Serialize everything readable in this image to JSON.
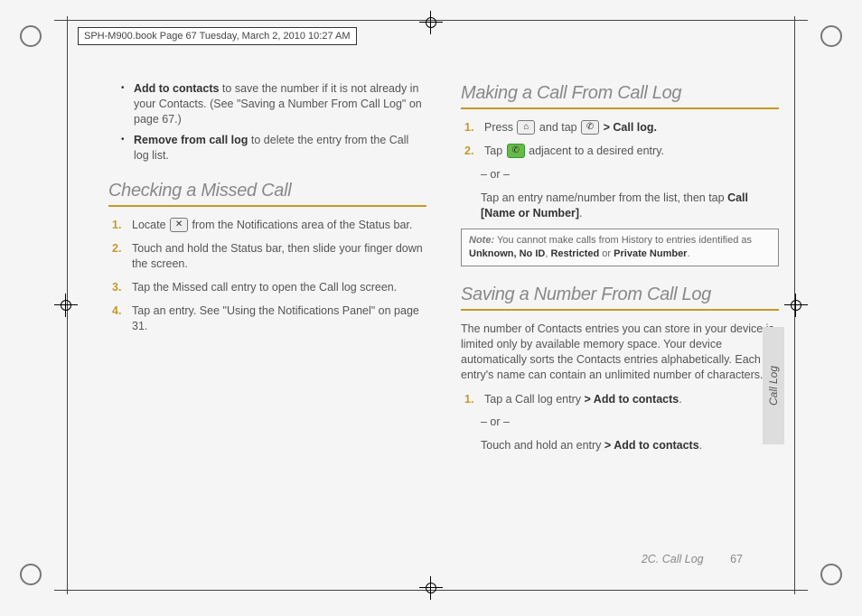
{
  "header": {
    "stamp": "SPH-M900.book  Page 67  Tuesday, March 2, 2010  10:27 AM"
  },
  "col1": {
    "bullets": [
      {
        "lead": "Add to contacts",
        "rest": " to save the number if it is not already in your Contacts. (See \"Saving a Number From Call Log\" on page 67.)"
      },
      {
        "lead": "Remove from call log",
        "rest": " to delete the entry from the Call log list."
      }
    ],
    "h1": "Checking a Missed Call",
    "steps": [
      {
        "pre": "Locate ",
        "icon": "missed-call-icon",
        "post": " from the Notifications area of the Status bar."
      },
      {
        "text": "Touch and hold the Status bar, then slide your finger down the screen."
      },
      {
        "text": "Tap the Missed call entry to open the Call log screen."
      },
      {
        "text": "Tap an entry. See \"Using the Notifications Panel\" on page 31."
      }
    ]
  },
  "col2": {
    "h1": "Making a Call From Call Log",
    "s1": {
      "pre": "Press ",
      "icon1": "home-icon",
      "mid": " and tap ",
      "icon2": "phone-icon",
      "gt": " > ",
      "boldend": "Call log."
    },
    "s2": {
      "pre": "Tap ",
      "icon": "call-green-icon",
      "post": " adjacent to a desired entry."
    },
    "or": "– or –",
    "s2b_a": "Tap an entry name/number from the list, then tap ",
    "s2b_b": "Call [Name or Number]",
    "s2b_c": ".",
    "note_label": "Note:",
    "note_a": " You cannot make calls from History to entries identified as ",
    "note_b": "Unknown, No ID",
    "note_c": ", ",
    "note_d": "Restricted",
    "note_e": " or ",
    "note_f": "Private Number",
    "note_g": ".",
    "h2": "Saving a Number From Call Log",
    "para": "The number of Contacts entries you can store in your device is limited only by available memory space. Your device automatically sorts the Contacts entries alphabetically. Each entry's name can contain an unlimited number of characters.",
    "s3_a": "Tap a Call log entry ",
    "s3_b": "> ",
    "s3_c": "Add to contacts",
    "s3_d": ".",
    "s3or": "– or –",
    "s3b_a": "Touch and hold an entry ",
    "s3b_b": "> ",
    "s3b_c": "Add to contacts",
    "s3b_d": "."
  },
  "footer": {
    "section": "2C. Call Log",
    "page": "67"
  },
  "tab": {
    "label": "Call Log"
  }
}
